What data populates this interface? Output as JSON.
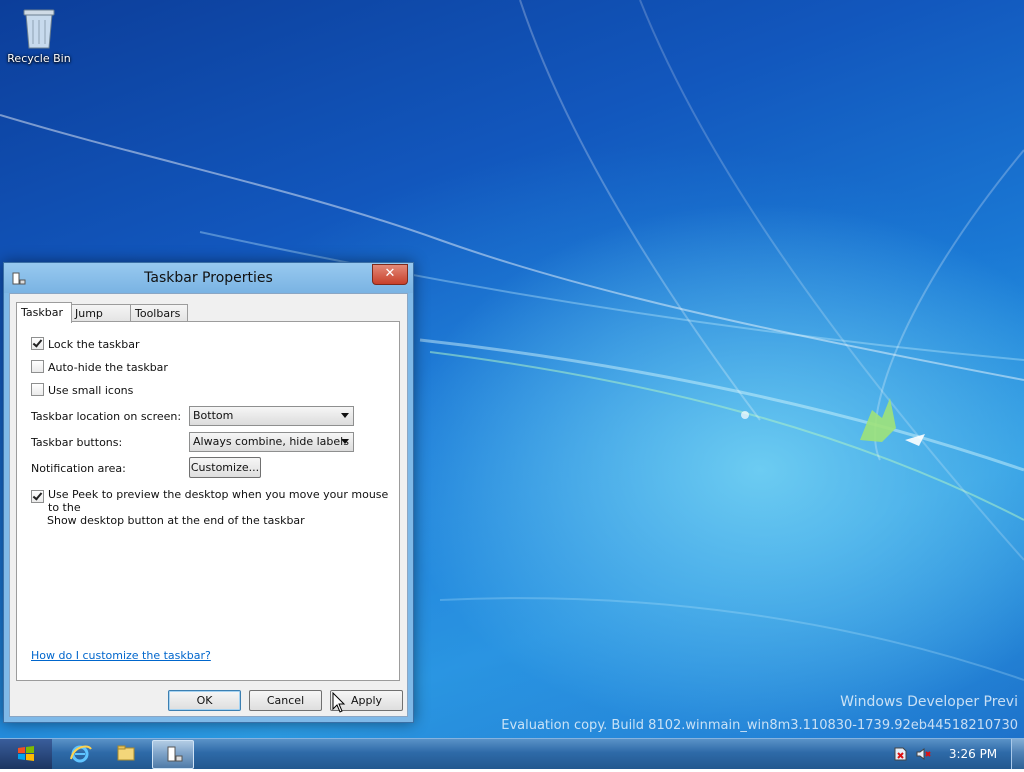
{
  "desktop": {
    "icons": [
      {
        "label": "Recycle Bin",
        "icon": "recycle-bin-icon"
      }
    ],
    "watermark": {
      "line1": "Windows Developer Previ",
      "line2": "Evaluation copy. Build 8102.winmain_win8m3.110830-1739.92eb44518210730"
    }
  },
  "dialog": {
    "title": "Taskbar Properties",
    "close_label": "✕",
    "tabs": [
      {
        "label": "Taskbar",
        "active": true
      },
      {
        "label": "Jump Lists",
        "active": false
      },
      {
        "label": "Toolbars",
        "active": false
      }
    ],
    "options": {
      "lock_taskbar": {
        "label": "Lock the taskbar",
        "checked": true
      },
      "auto_hide": {
        "label": "Auto-hide the taskbar",
        "checked": false
      },
      "small_icons": {
        "label": "Use small icons",
        "checked": false
      }
    },
    "location": {
      "label": "Taskbar location on screen:",
      "value": "Bottom"
    },
    "buttons_setting": {
      "label": "Taskbar buttons:",
      "value": "Always combine, hide labels"
    },
    "notification": {
      "label": "Notification area:",
      "button": "Customize..."
    },
    "peek": {
      "line1": "Use Peek to preview the desktop when you move your mouse to the",
      "line2": "Show desktop button at the end of the taskbar",
      "checked": true
    },
    "help_link": "How do I customize the taskbar?",
    "footer": {
      "ok": "OK",
      "cancel": "Cancel",
      "apply": "Apply"
    }
  },
  "taskbar": {
    "start_icon": "windows-logo-icon",
    "pinned": [
      "internet-explorer-icon",
      "file-explorer-icon",
      "taskbar-properties-icon"
    ],
    "tray_icons": [
      "action-center-icon",
      "volume-muted-icon"
    ],
    "clock": "3:26 PM"
  },
  "colors": {
    "accent": "#1a78d4",
    "dialog_frame": "#7fb9e8",
    "link": "#0066cc",
    "close": "#c7402b"
  }
}
